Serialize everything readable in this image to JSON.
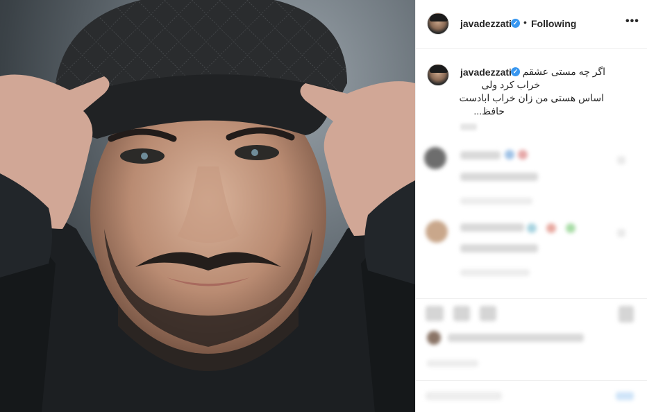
{
  "post": {
    "username": "javadezzati",
    "verified_mark": "✓",
    "separator": "•",
    "follow_status": "Following",
    "more_label": "•••"
  },
  "caption": {
    "username": "javadezzati",
    "lines": [
      "اگر چه مستی عشقم",
      "خراب کرد ولی",
      "اساس هستی من زان خراب ابادست",
      "حافظ..."
    ]
  },
  "icons": {
    "verified": "verified-badge-icon",
    "more": "more-options-icon"
  },
  "colors": {
    "verified_blue": "#3897f0",
    "border": "#efefef",
    "text": "#262626"
  }
}
